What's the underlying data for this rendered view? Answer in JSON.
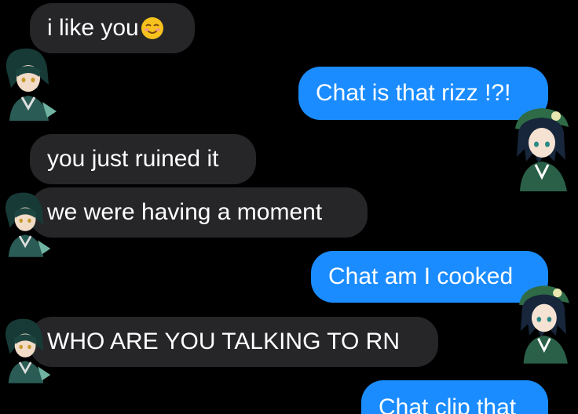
{
  "conversation": {
    "messages": [
      {
        "sender": "them",
        "text": "i like you",
        "emoji": "smiling-face-with-smiling-eyes"
      },
      {
        "sender": "me",
        "text": "Chat is that rizz !?!"
      },
      {
        "sender": "them",
        "text": "you just ruined it"
      },
      {
        "sender": "them",
        "text": "we were having a moment"
      },
      {
        "sender": "me",
        "text": "Chat am I cooked"
      },
      {
        "sender": "them",
        "text": "WHO ARE YOU TALKING TO RN"
      },
      {
        "sender": "me",
        "text": "Chat clip that"
      }
    ]
  },
  "colors": {
    "background": "#000000",
    "received_bubble": "#262629",
    "sent_bubble": "#1a8cff",
    "text": "#ffffff"
  },
  "icons": {
    "left_avatar": "dark-haired-character-avatar-icon",
    "right_avatar": "green-beret-character-avatar-icon"
  }
}
